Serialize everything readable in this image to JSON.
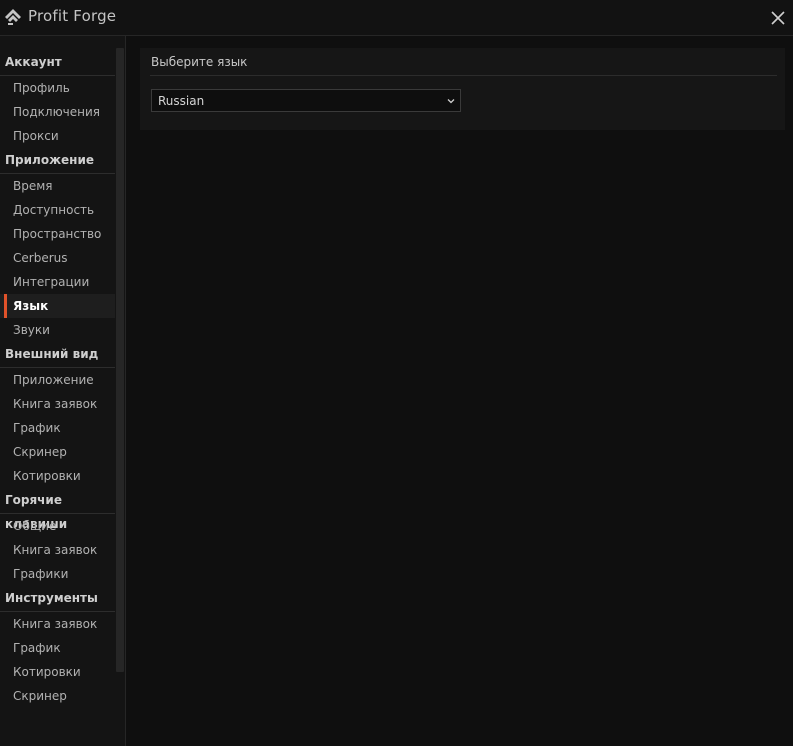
{
  "app": {
    "title": "Profit Forge"
  },
  "sidebar": {
    "sections": [
      {
        "header": "Аккаунт",
        "items": [
          "Профиль",
          "Подключения",
          "Прокси"
        ]
      },
      {
        "header": "Приложение",
        "items": [
          "Время",
          "Доступность",
          "Пространство",
          "Cerberus",
          "Интеграции",
          "Язык",
          "Звуки"
        ]
      },
      {
        "header": "Внешний вид",
        "items": [
          "Приложение",
          "Книга заявок",
          "График",
          "Скринер",
          "Котировки"
        ]
      },
      {
        "header": "Горячие клавиши",
        "items": [
          "Общие",
          "Книга заявок",
          "Графики"
        ]
      },
      {
        "header": "Инструменты",
        "items": [
          "Книга заявок",
          "График",
          "Котировки",
          "Скринер"
        ]
      }
    ],
    "active_item": "Язык"
  },
  "language_panel": {
    "title": "Выберите язык",
    "selected": "Russian"
  },
  "colors": {
    "accent": "#e0522a",
    "background": "#0f0f0f"
  }
}
